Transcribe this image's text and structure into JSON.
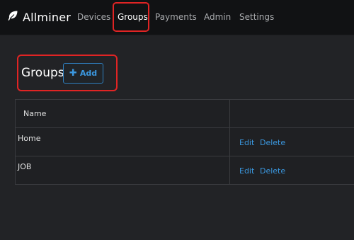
{
  "brand": {
    "name": "Allminer",
    "icon": "leaf-icon"
  },
  "nav": {
    "devices": "Devices",
    "groups": "Groups",
    "payments": "Payments",
    "admin": "Admin",
    "settings": "Settings",
    "active": "Groups"
  },
  "page": {
    "title": "Groups",
    "add_label": "Add"
  },
  "table": {
    "headers": [
      "Name",
      ""
    ],
    "rows": [
      {
        "name": "Home",
        "edit": "Edit",
        "delete": "Delete"
      },
      {
        "name": "JOB",
        "edit": "Edit",
        "delete": "Delete"
      }
    ]
  },
  "colors": {
    "accent": "#3b98e0",
    "highlight": "#e02424",
    "background": "#222326",
    "navbar": "#111214"
  }
}
